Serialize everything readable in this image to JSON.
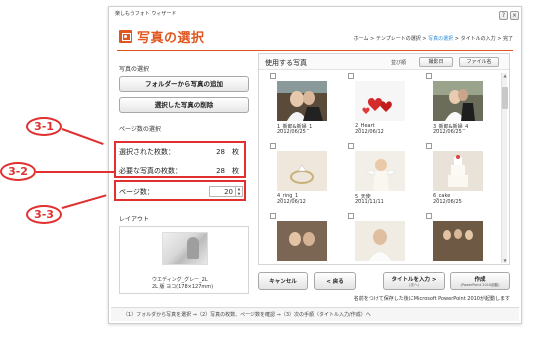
{
  "window": {
    "app_name": "楽しもうフォト ウィザード",
    "help_button": "?",
    "close_button": "×",
    "title": "写真の選択",
    "breadcrumb": {
      "home": "ホーム",
      "template": "テンプレートの選択",
      "photos": "写真の選択",
      "titles": "タイトルの入力",
      "done": "完了",
      "separator": ">"
    }
  },
  "left_panel": {
    "photo_select_label": "写真の選択",
    "add_from_folder_button": "フォルダーから写真の追加",
    "delete_selected_button": "選択した写真の削除",
    "page_count_label": "ページ数の選択",
    "selected_count_label": "選択された枚数：",
    "selected_count_value": "28",
    "required_count_label": "必要な写真の枚数：",
    "required_count_value": "28",
    "count_unit": "枚",
    "pages_label": "ページ数：",
    "pages_value": "20",
    "layout_label": "レイアウト",
    "layout_name": "ウエディング_グレー_2L",
    "layout_size": "2L 版 ヨコ(178×127mm)"
  },
  "photo_panel": {
    "title": "使用する写真",
    "sort_label": "並び順",
    "sort_by_date": "撮影日",
    "sort_by_filename": "ファイル名",
    "photos": [
      {
        "caption": "1_新郎&新婦_1",
        "date": "2012/06/25"
      },
      {
        "caption": "2_Heart",
        "date": "2012/06/12"
      },
      {
        "caption": "3_新郎&新婦_4",
        "date": "2012/06/25"
      },
      {
        "caption": "4_ring_1",
        "date": "2012/06/12"
      },
      {
        "caption": "5_天使",
        "date": "2011/11/11"
      },
      {
        "caption": "6_cake",
        "date": "2012/06/25"
      },
      {
        "caption": "",
        "date": ""
      },
      {
        "caption": "",
        "date": ""
      },
      {
        "caption": "",
        "date": ""
      }
    ]
  },
  "buttons": {
    "cancel": "キャンセル",
    "back": "< 戻る",
    "next": "タイトルを入力 >",
    "next_sub": "(次へ)",
    "create": "作成",
    "create_sub": "(PowerPoint 2010起動)"
  },
  "note": "名前をつけて保存した後にMicrosoft PowerPoint 2010が起動します",
  "footer": "（1）フォルダから写真を選択 ⇒（2）写真の枚数、ページ数を確認 ⇒（3）次の手順（タイトル入力/作成）へ",
  "annotations": {
    "a1": "3-1",
    "a2": "3-2",
    "a3": "3-3"
  },
  "colors": {
    "accent": "#e1561f",
    "annotation": "#e03030",
    "link": "#2a8bd8"
  }
}
